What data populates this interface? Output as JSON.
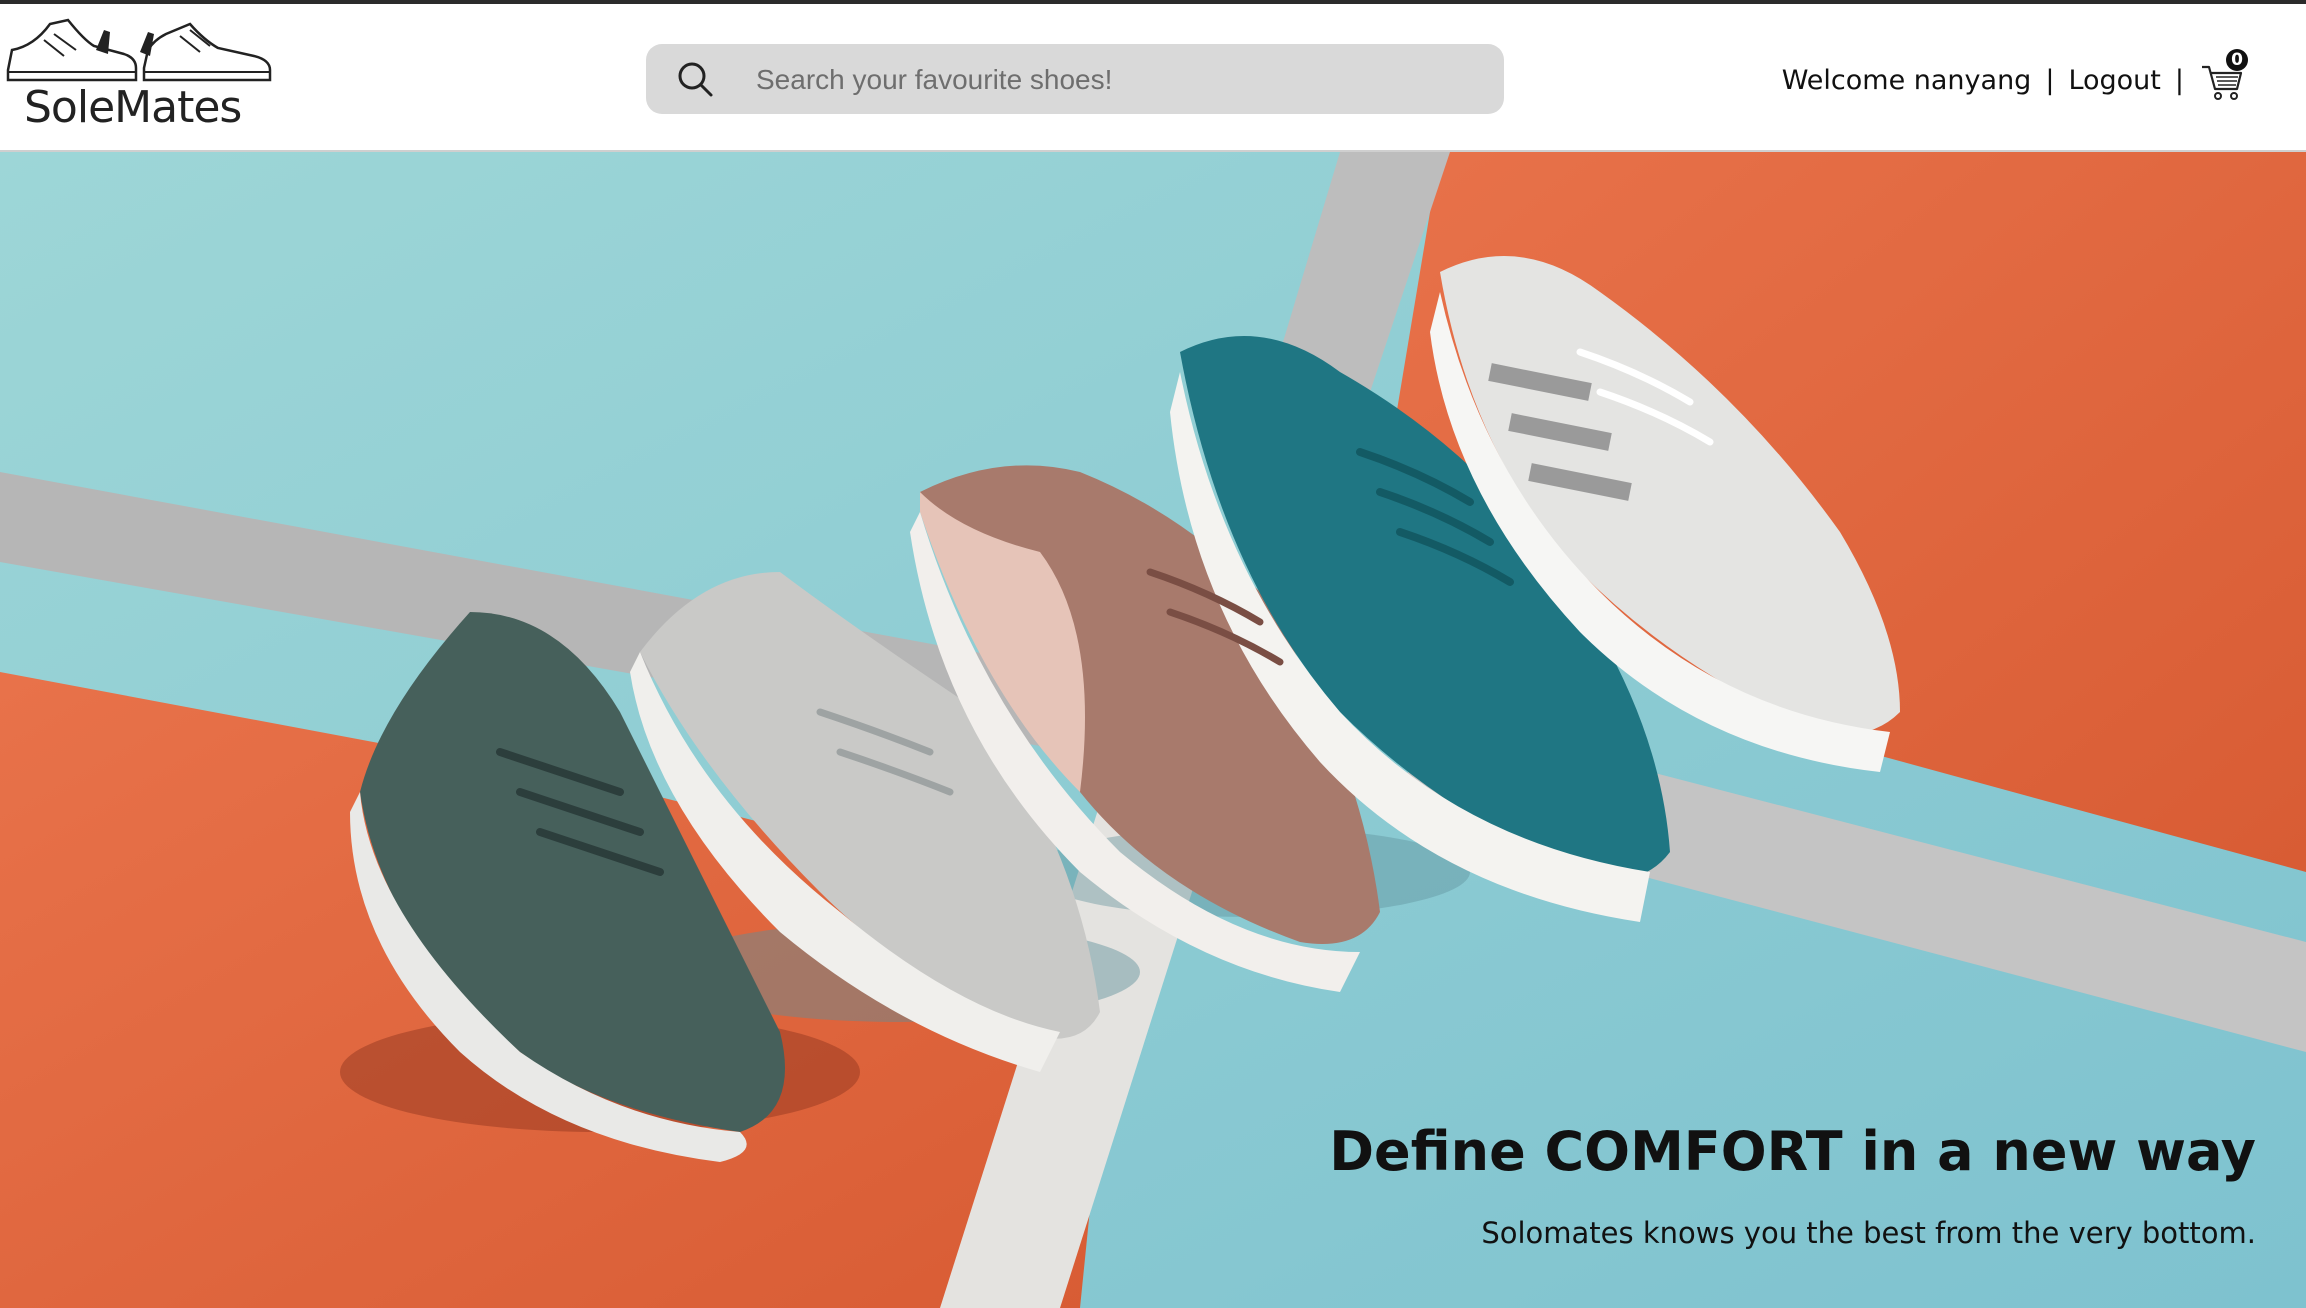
{
  "brand": {
    "name": "SoleMates"
  },
  "search": {
    "placeholder": "Search your favourite shoes!",
    "value": ""
  },
  "user": {
    "welcome": "Welcome nanyang",
    "separator": "|",
    "logout_label": "Logout"
  },
  "cart": {
    "count": "0"
  },
  "hero": {
    "headline": "Define COMFORT in a new way",
    "subline": "Solomates knows you the best from the very bottom.",
    "colors": {
      "teal": "#8ccfd3",
      "orange": "#e0683f",
      "gray": "#b9b9b9",
      "white": "#ececea"
    }
  }
}
